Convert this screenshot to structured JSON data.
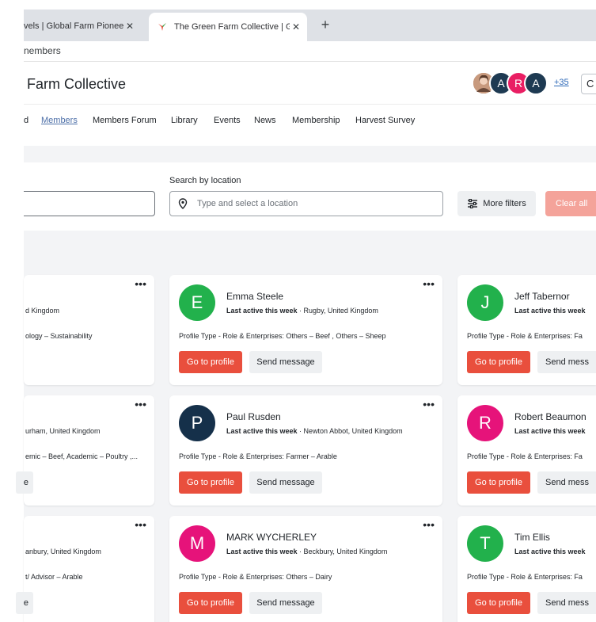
{
  "browser": {
    "tabs": [
      {
        "title": "vels | Global Farm Pioneer",
        "active": false
      },
      {
        "title": "The Green Farm Collective | Gl",
        "active": true
      }
    ],
    "new_tab": "+",
    "close": "✕",
    "address": "nembers"
  },
  "header": {
    "site_title": "Farm Collective",
    "avatars": [
      {
        "letter": "",
        "color": "#8a5a44"
      },
      {
        "letter": "A",
        "color": "#1e3a52"
      },
      {
        "letter": "R",
        "color": "#e91e63"
      },
      {
        "letter": "A",
        "color": "#1e3a52"
      }
    ],
    "extra_count": "+35",
    "cut_button": "C"
  },
  "nav": {
    "items": [
      "d",
      "Members",
      "Members Forum",
      "Library",
      "Events",
      "News",
      "Membership",
      "Harvest Survey"
    ],
    "active": "Members"
  },
  "filters": {
    "location_label": "Search by location",
    "location_placeholder": "Type and select a location",
    "more_filters": "More filters",
    "clear_all": "Clear all"
  },
  "members": {
    "left_column": [
      {
        "location": "d Kingdom",
        "profile": "ology – Sustainability"
      },
      {
        "location": "urham, United Kingdom",
        "profile": "emic – Beef, Academic – Poultry ,...",
        "message_cut": "e"
      },
      {
        "location": "anbury, United Kingdom",
        "profile": "t/ Advisor – Arable",
        "message_cut": "e"
      }
    ],
    "middle_column": [
      {
        "initial": "E",
        "color": "#22b14c",
        "name": "Emma Steele",
        "active": "Last active this week",
        "location": "Rugby, United Kingdom",
        "profile_label": "Profile Type - Role & Enterprises:",
        "profile": "Others – Beef , Others – Sheep"
      },
      {
        "initial": "P",
        "color": "#15304a",
        "name": "Paul Rusden",
        "active": "Last active this week",
        "location": "Newton Abbot, United Kingdom",
        "profile_label": "Profile Type - Role & Enterprises:",
        "profile": "Farmer – Arable"
      },
      {
        "initial": "M",
        "color": "#e6137a",
        "name": "MARK WYCHERLEY",
        "active": "Last active this week",
        "location": "Beckbury, United Kingdom",
        "profile_label": "Profile Type - Role & Enterprises:",
        "profile": "Others – Dairy"
      }
    ],
    "right_column": [
      {
        "initial": "J",
        "color": "#22b14c",
        "name": "Jeff Tabernor",
        "active": "Last active this week",
        "profile_label": "Profile Type - Role & Enterprises: Fa"
      },
      {
        "initial": "R",
        "color": "#e6137a",
        "name": "Robert Beaumon",
        "active": "Last active this week",
        "profile_label": "Profile Type - Role & Enterprises: Fa"
      },
      {
        "initial": "T",
        "color": "#22b14c",
        "name": "Tim Ellis",
        "active": "Last active this week",
        "profile_label": "Profile Type - Role & Enterprises: Fa"
      }
    ],
    "go_to_profile": "Go to profile",
    "send_message": "Send message",
    "send_message_cut": "Send mess",
    "dots": "•••"
  }
}
